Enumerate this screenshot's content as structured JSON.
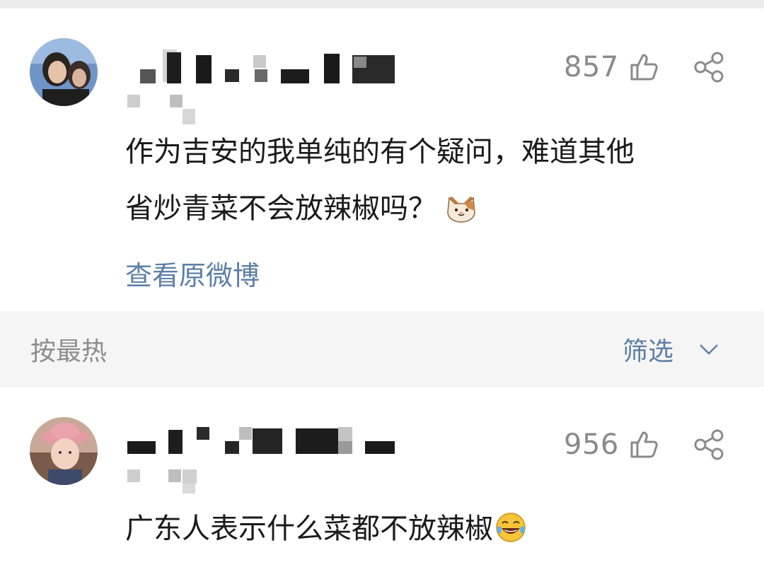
{
  "comments": [
    {
      "like_count": "857",
      "text_lines": [
        "作为吉安的我单纯的有个疑问，难道其他",
        "省炒青菜不会放辣椒吗？"
      ],
      "trailing_emoji": "cat-face-emoji",
      "view_original_label": "查看原微博"
    },
    {
      "like_count": "956",
      "text": "广东人表示什么菜都不放辣椒",
      "trailing_emoji": "laughing-tears-emoji"
    }
  ],
  "sort_bar": {
    "sort_label": "按最热",
    "filter_label": "筛选",
    "filter_icon": "chevron-down-icon"
  },
  "icons": {
    "like": "thumbs-up-icon",
    "share": "share-icon"
  },
  "colors": {
    "link_blue": "#5d7fa6",
    "count_gray": "#8a8a8a",
    "page_bg": "#f5f5f5"
  }
}
